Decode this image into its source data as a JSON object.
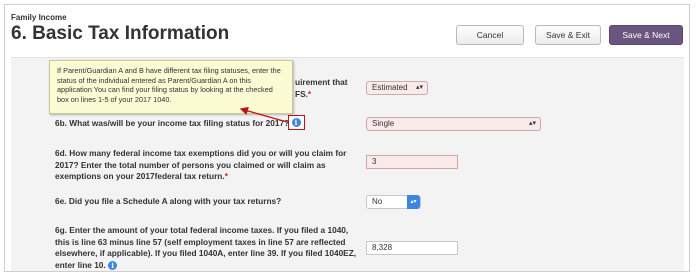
{
  "header": {
    "section_label": "Family Income",
    "title": "6. Basic Tax Information",
    "cancel_label": "Cancel",
    "save_exit_label": "Save & Exit",
    "save_next_label": "Save & Next"
  },
  "tooltip": {
    "text": "If Parent/Guardian A and B have different tax filing statuses, enter the status of the individual entered as Parent/Guardian A on this application You can find your filing status by looking at the checked box on lines 1-5 of your 2017 1040."
  },
  "questions": {
    "q6a_partial_line1": "uirement that",
    "q6a_partial_line2": "FS.",
    "q6a_value": "Estimated",
    "q6b_label": "6b. What was/will be your income tax filing status for 2017?",
    "q6b_value": "Single",
    "q6d_label": "6d. How many federal income tax exemptions did you or will you claim for 2017? Enter the total number of persons you claimed or will claim as exemptions on your 2017federal tax return.",
    "q6d_value": "3",
    "q6e_label": "6e. Did you file a Schedule A along with your tax returns?",
    "q6e_value": "No",
    "q6g_label": "6g. Enter the amount of your total federal income taxes. If you filed a 1040, this is line 63 minus line 57 (self employment taxes in line 57 are reflected elsewhere, if applicable). If you filed 1040A, enter line 39. If you filed 1040EZ, enter line 10.",
    "q6g_value": "8,328"
  },
  "colors": {
    "primary_button": "#6a557f",
    "required_marker": "#d02020",
    "info_icon": "#3a86e0",
    "highlight": "#c0141c",
    "tooltip_bg": "#fbfbd4",
    "error_field_bg": "#fbeaea"
  },
  "icons": {
    "info": "info-icon",
    "select_arrows": "updown-arrows-icon",
    "stepper": "stepper-icon"
  }
}
